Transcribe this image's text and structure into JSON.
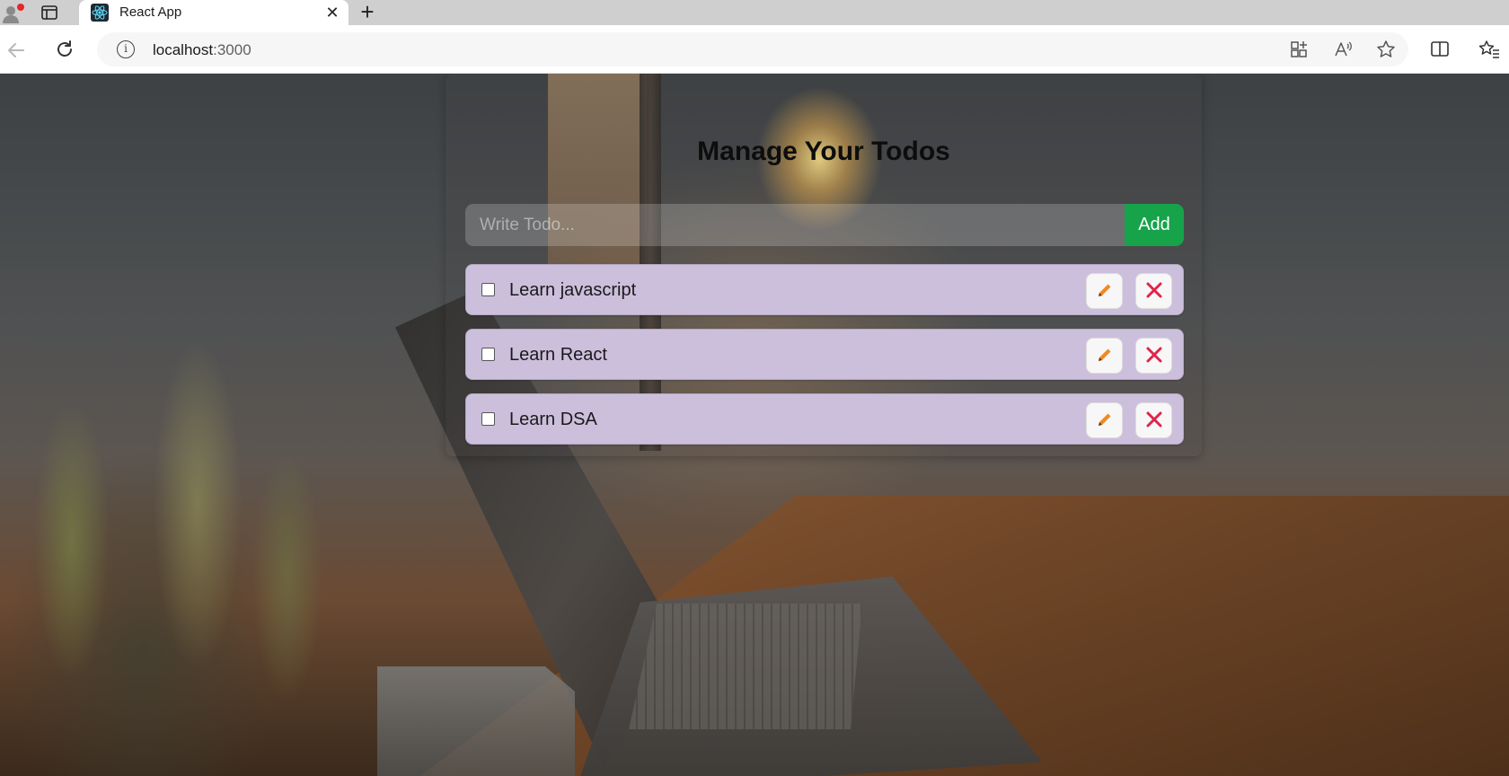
{
  "browser": {
    "tab_title": "React App",
    "tab_close": "✕",
    "new_tab": "+",
    "url_host": "localhost",
    "url_port": ":3000"
  },
  "app": {
    "title": "Manage Your Todos",
    "input_placeholder": "Write Todo...",
    "add_label": "Add",
    "todos": [
      {
        "text": "Learn javascript",
        "completed": false
      },
      {
        "text": "Learn React",
        "completed": false
      },
      {
        "text": "Learn DSA",
        "completed": false
      }
    ]
  },
  "colors": {
    "add_button": "#16a34a",
    "todo_bg": "#ccbfdc",
    "edit_icon": "#f08a24",
    "delete_icon": "#e0244a"
  },
  "icons": {
    "edit": "pencil-icon",
    "delete": "close-icon"
  }
}
